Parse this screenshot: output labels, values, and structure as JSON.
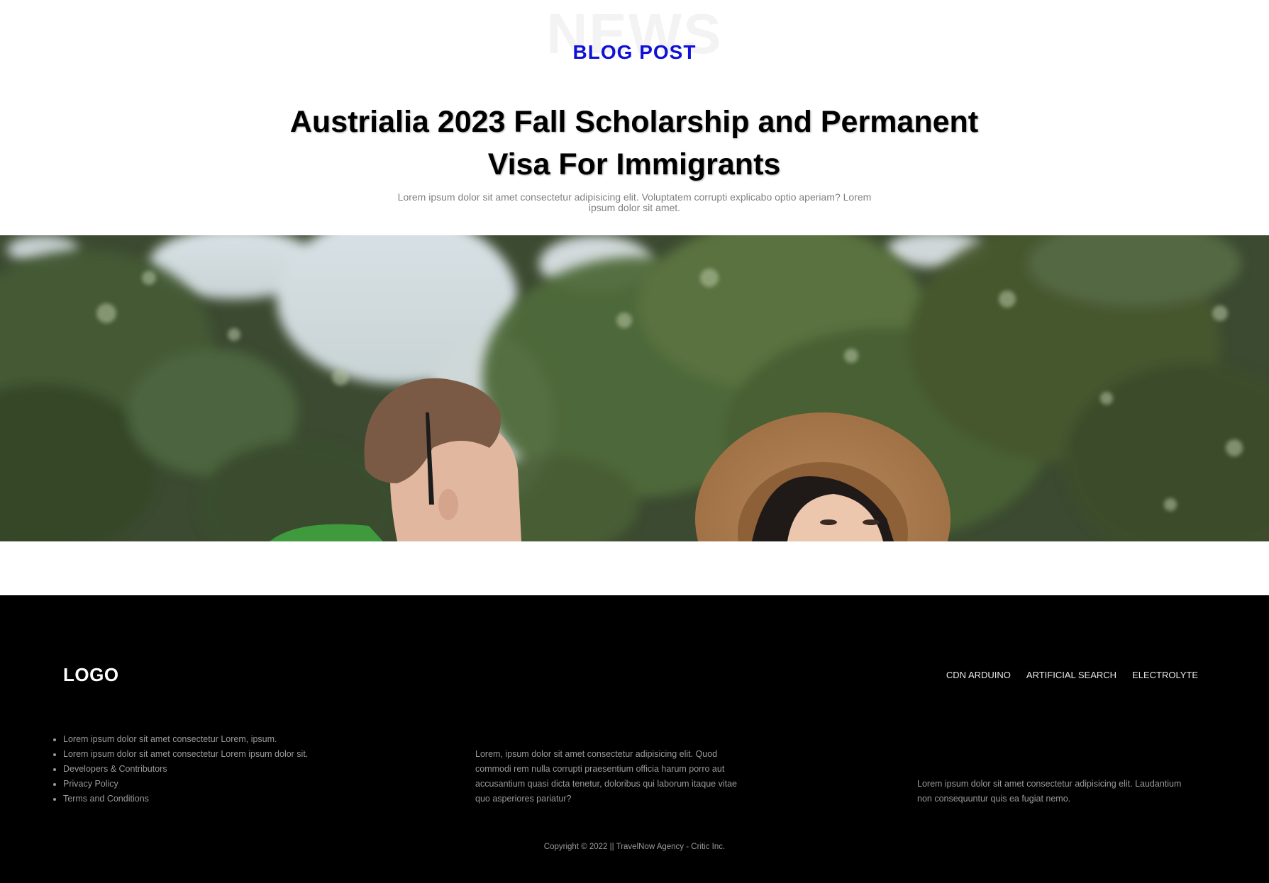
{
  "hero": {
    "background_word": "NEWS",
    "eyebrow": "BLOG POST",
    "title": "Austrialia 2023 Fall Scholarship and Permanent Visa For Immigrants",
    "subtitle": "Lorem ipsum dolor sit amet consectetur adipisicing elit. Voluptatem corrupti explicabo optio aperiam? Lorem ipsum dolor sit amet.",
    "eyebrow_color": "#1010d8"
  },
  "footer": {
    "logo": "LOGO",
    "nav": [
      {
        "label": "CDN ARDUINO"
      },
      {
        "label": "ARTIFICIAL SEARCH"
      },
      {
        "label": "ELECTROLYTE"
      }
    ],
    "links": [
      {
        "label": "Lorem ipsum dolor sit amet consectetur Lorem, ipsum."
      },
      {
        "label": "Lorem ipsum dolor sit amet consectetur Lorem ipsum dolor sit."
      },
      {
        "label": "Developers & Contributors"
      },
      {
        "label": "Privacy Policy"
      },
      {
        "label": "Terms and Conditions"
      }
    ],
    "column2_text": "Lorem, ipsum dolor sit amet consectetur adipisicing elit. Quod commodi rem nulla corrupti praesentium officia harum porro aut accusantium quasi dicta tenetur, doloribus qui laborum itaque vitae quo asperiores pariatur?",
    "column3_text": "Lorem ipsum dolor sit amet consectetur adipisicing elit. Laudantium non consequuntur quis ea fugiat nemo.",
    "copyright": "Copyright © 2022 || TravelNow Agency - Critic Inc."
  }
}
